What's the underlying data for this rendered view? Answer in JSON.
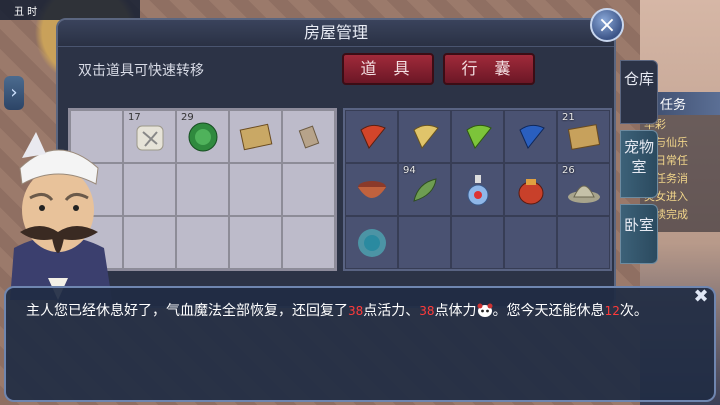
{
  "status": {
    "time_label": "丑 时"
  },
  "window": {
    "title": "房屋管理",
    "close_icon": "close-x"
  },
  "hint": "双击道具可快速转移",
  "tabs": [
    {
      "label": "道 具"
    },
    {
      "label": "行 囊"
    }
  ],
  "side_tabs": [
    {
      "label": "仓库"
    },
    {
      "label": "宠物室"
    },
    {
      "label": "卧室"
    }
  ],
  "quest": {
    "title": "任务",
    "lines": [
      "华彩",
      "参与仙乐",
      "个日常任",
      "若任务消",
      "灵女进入",
      "继续完成"
    ]
  },
  "left_grid": [
    {
      "count": "",
      "icon": "empty"
    },
    {
      "count": "17",
      "icon": "scroll-stone-icon"
    },
    {
      "count": "29",
      "icon": "green-jade-icon"
    },
    {
      "count": "",
      "icon": "map-scroll-icon"
    },
    {
      "count": "",
      "icon": "paper-scroll-icon"
    },
    {
      "count": "",
      "icon": "empty"
    },
    {
      "count": "",
      "icon": "empty"
    },
    {
      "count": "",
      "icon": "empty"
    },
    {
      "count": "",
      "icon": "empty"
    },
    {
      "count": "",
      "icon": "empty"
    },
    {
      "count": "",
      "icon": "empty"
    },
    {
      "count": "",
      "icon": "empty"
    },
    {
      "count": "",
      "icon": "empty"
    },
    {
      "count": "",
      "icon": "empty"
    },
    {
      "count": "",
      "icon": "empty"
    }
  ],
  "right_grid": [
    {
      "count": "",
      "icon": "red-fan-icon"
    },
    {
      "count": "",
      "icon": "yellow-fan-icon"
    },
    {
      "count": "",
      "icon": "green-fan-icon"
    },
    {
      "count": "",
      "icon": "blue-fan-icon"
    },
    {
      "count": "21",
      "icon": "treasure-map-icon"
    },
    {
      "count": "",
      "icon": "bowl-icon"
    },
    {
      "count": "94",
      "icon": "herb-leaf-icon"
    },
    {
      "count": "",
      "icon": "potion-bottle-icon"
    },
    {
      "count": "",
      "icon": "red-pouch-icon"
    },
    {
      "count": "26",
      "icon": "hat-icon"
    },
    {
      "count": "",
      "icon": "glowing-orb-icon"
    },
    {
      "count": "",
      "icon": "empty"
    },
    {
      "count": "",
      "icon": "empty"
    },
    {
      "count": "",
      "icon": "empty"
    },
    {
      "count": "",
      "icon": "empty"
    }
  ],
  "dialog": {
    "part1": "主人您已经休息好了，气血魔法全部恢复，还回复了",
    "num1": "38",
    "part2": "点活力、",
    "num2": "38",
    "part3": "点体力",
    "part4": "。您今天还能休息",
    "num3": "12",
    "part5": "次。",
    "emote_icon": "panda-emote-icon",
    "close_icon": "close-x"
  },
  "colors": {
    "highlight_number": "#ff3a3a",
    "tab_red": "#a12a3a"
  }
}
